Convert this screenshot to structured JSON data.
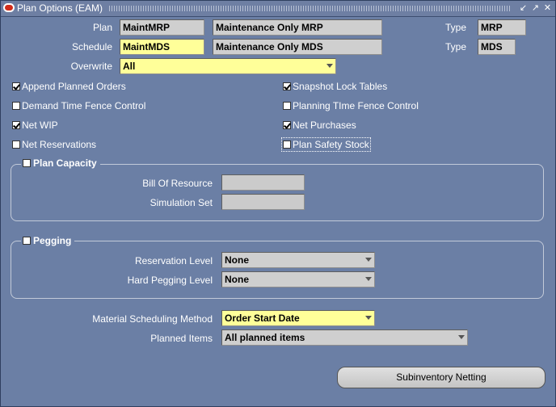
{
  "window": {
    "title": "Plan Options (EAM)",
    "controls": [
      "minimize",
      "maximize",
      "close"
    ]
  },
  "plan": {
    "label": "Plan",
    "value": "MaintMRP",
    "description": "Maintenance Only MRP",
    "type_label": "Type",
    "type_value": "MRP"
  },
  "schedule": {
    "label": "Schedule",
    "value": "MaintMDS",
    "description": "Maintenance Only MDS",
    "type_label": "Type",
    "type_value": "MDS"
  },
  "overwrite": {
    "label": "Overwrite",
    "value": "All"
  },
  "options": [
    {
      "label": "Append Planned Orders",
      "checked": true
    },
    {
      "label": "Snapshot Lock Tables",
      "checked": true
    },
    {
      "label": "Demand Time Fence Control",
      "checked": false
    },
    {
      "label": "Planning TIme Fence Control",
      "checked": false
    },
    {
      "label": "Net WIP",
      "checked": true
    },
    {
      "label": "Net Purchases",
      "checked": true
    },
    {
      "label": "Net Reservations",
      "checked": false
    },
    {
      "label": "Plan Safety Stock",
      "checked": false
    }
  ],
  "plan_capacity": {
    "title": "Plan Capacity",
    "checked": false,
    "bill_of_resource_label": "Bill Of Resource",
    "bill_of_resource_value": "",
    "simulation_set_label": "Simulation Set",
    "simulation_set_value": ""
  },
  "pegging": {
    "title": "Pegging",
    "checked": false,
    "reservation_level_label": "Reservation Level",
    "reservation_level_value": "None",
    "hard_pegging_level_label": "Hard Pegging Level",
    "hard_pegging_level_value": "None"
  },
  "material_scheduling": {
    "label": "Material Scheduling Method",
    "value": "Order Start Date"
  },
  "planned_items": {
    "label": "Planned Items",
    "value": "All planned items"
  },
  "buttons": {
    "subinventory_netting": "Subinventory Netting"
  },
  "colors": {
    "background": "#6b7fa5",
    "required_field": "#ffff99",
    "field": "#cfcfcf"
  }
}
